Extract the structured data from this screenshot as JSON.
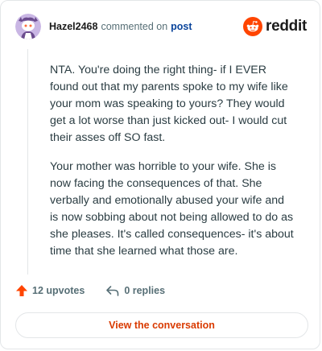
{
  "comment": {
    "username": "Hazel2468",
    "commented_text": "commented on",
    "post_link": "post",
    "brand": "reddit",
    "paragraphs": [
      "NTA. You're doing the right thing- if I EVER found out that my parents spoke to my wife like your mom was speaking to yours? They would get a lot worse than just kicked out- I would cut their asses off SO fast.",
      "Your mother was horrible to your wife. She is now facing the consequences of that. She verbally and emotionally abused your wife and is now sobbing about not being allowed to do as she pleases. It's called consequences- it's about time that she learned what those are."
    ],
    "upvotes": "12 upvotes",
    "replies": "0 replies",
    "cta": "View the conversation"
  },
  "icons": {
    "avatar": "snoo-avatar-icon",
    "brand": "reddit-logo-icon",
    "upvote": "upvote-arrow-icon",
    "reply": "reply-arrow-icon"
  },
  "colors": {
    "accent": "#ff4500",
    "link": "#0a449b",
    "cta_text": "#d93a00",
    "muted": "#576f76",
    "border": "#e3e6e8"
  }
}
